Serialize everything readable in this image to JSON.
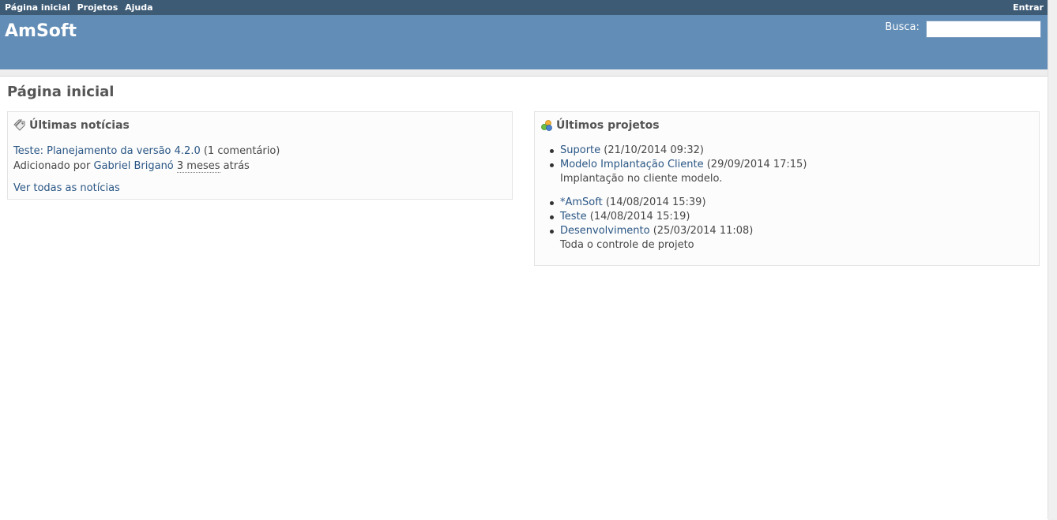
{
  "top_menu": {
    "items": [
      "Página inicial",
      "Projetos",
      "Ajuda"
    ],
    "login": "Entrar"
  },
  "header": {
    "title": "AmSoft",
    "search_label": "Busca:",
    "search_value": ""
  },
  "page": {
    "title": "Página inicial"
  },
  "news": {
    "heading": "Últimas notícias",
    "item_link": "Teste: Planejamento da versão 4.2.0",
    "item_comments": "(1 comentário)",
    "added_by": "Adicionado por",
    "author": "Gabriel Briganó",
    "ago": "3 meses",
    "ago_suffix": "atrás",
    "view_all": "Ver todas as notícias"
  },
  "projects": {
    "heading": "Últimos projetos",
    "items": [
      {
        "name": "Suporte",
        "date": "(21/10/2014 09:32)",
        "desc": ""
      },
      {
        "name": "Modelo Implantação Cliente",
        "date": "(29/09/2014 17:15)",
        "desc": "Implantação no cliente modelo."
      },
      {
        "name": "*AmSoft",
        "date": "(14/08/2014 15:39)",
        "desc": ""
      },
      {
        "name": "Teste",
        "date": "(14/08/2014 15:19)",
        "desc": ""
      },
      {
        "name": "Desenvolvimento",
        "date": "(25/03/2014 11:08)",
        "desc": "Toda o controle de projeto"
      }
    ]
  },
  "icons": {
    "news": "news-tag-icon",
    "projects": "projects-icon"
  },
  "colors": {
    "top_menu": "#3e5b76",
    "header": "#628db6",
    "link": "#2a5685"
  }
}
